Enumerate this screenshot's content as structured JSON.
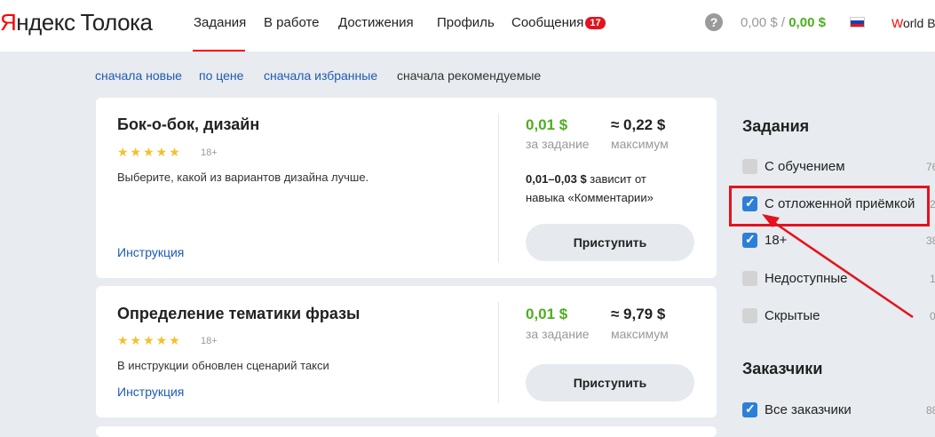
{
  "header": {
    "logo_yandex_y": "Я",
    "logo_yandex_rest": "ндекс",
    "logo_toloka": "Толока",
    "nav": [
      {
        "label": "Задания",
        "active": true
      },
      {
        "label": "В работе"
      },
      {
        "label": "Достижения"
      },
      {
        "label": "Профиль"
      },
      {
        "label": "Сообщения",
        "badge": "17"
      }
    ],
    "help": "?",
    "balance_grey": "0,00 $ /",
    "balance_green": "0,00 $",
    "world_w": "W",
    "world_rest": "orld B"
  },
  "sort": [
    {
      "label": "сначала новые",
      "active": false
    },
    {
      "label": "по цене",
      "active": false
    },
    {
      "label": "сначала избранные",
      "active": false
    },
    {
      "label": "сначала рекомендуемые",
      "active": true
    }
  ],
  "tasks": [
    {
      "title": "Бок-о-бок, дизайн",
      "stars": "★★★★★",
      "age": "18+",
      "description": "Выберите, какой из вариантов дизайна лучше.",
      "instruction": "Инструкция",
      "price": "0,01 $",
      "price_label": "за задание",
      "max": "≈ 0,22 $",
      "max_label": "максимум",
      "range": "0,01–0,03 $",
      "range_text1": " зависит от",
      "range_text2": "навыка «Комментарии»",
      "button": "Приступить"
    },
    {
      "title": "Определение тематики фразы",
      "stars": "★★★★★",
      "age": "18+",
      "description": "В инструкции обновлен сценарий такси",
      "instruction": "Инструкция",
      "price": "0,01 $",
      "price_label": "за задание",
      "max": "≈ 9,79 $",
      "max_label": "максимум",
      "button": "Приступить"
    }
  ],
  "filters": {
    "tasks_title": "Задания",
    "items": [
      {
        "label": "С обучением",
        "checked": false,
        "count": "76"
      },
      {
        "label": "С отложенной приёмкой",
        "checked": true,
        "count": "2"
      },
      {
        "label": "18+",
        "checked": true,
        "count": "38"
      },
      {
        "label": "Недоступные",
        "checked": false,
        "count": "1"
      },
      {
        "label": "Скрытые",
        "checked": false,
        "count": "0"
      }
    ],
    "customers_title": "Заказчики",
    "customers": [
      {
        "label": "Все заказчики",
        "checked": true,
        "count": "88"
      }
    ]
  },
  "colors": {
    "accent_red": "#e3131d",
    "price_green": "#4caf1e",
    "link_blue": "#1e5bb2",
    "checkbox_blue": "#2d7fd6",
    "page_bg": "#e8ebef"
  }
}
